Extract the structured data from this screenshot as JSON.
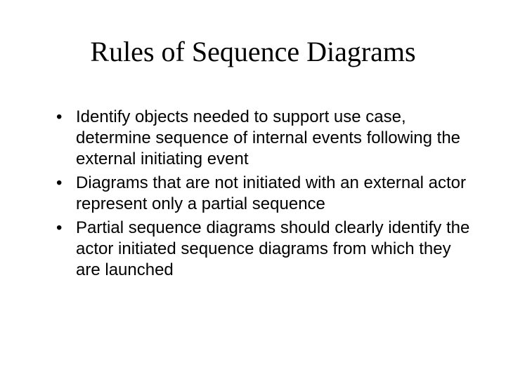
{
  "slide": {
    "title": "Rules of Sequence Diagrams",
    "bullets": [
      "Identify objects needed to support use case, determine sequence of internal events following the external initiating event",
      "Diagrams that are not initiated with an external actor represent only a partial sequence",
      "Partial sequence diagrams should clearly identify the actor initiated sequence diagrams from which they are launched"
    ]
  }
}
